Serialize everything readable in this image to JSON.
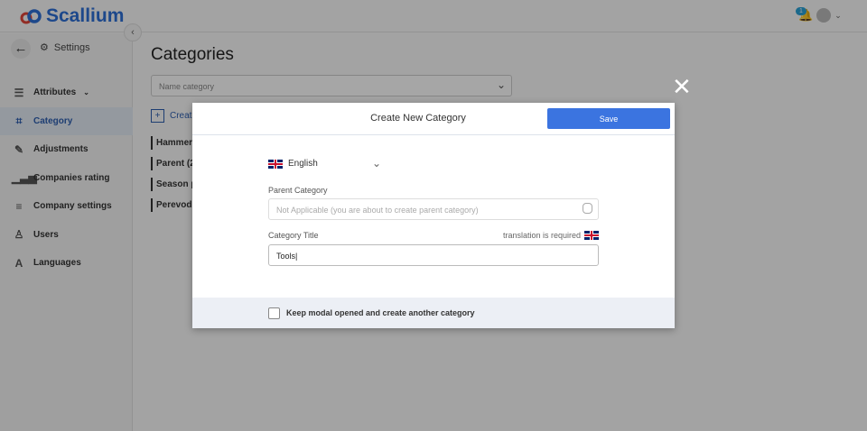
{
  "app": {
    "name": "Scallium",
    "notification_count": "1"
  },
  "sidebar": {
    "back_label": "Settings",
    "items": [
      {
        "label": "Attributes",
        "icon": "list-plus-icon"
      },
      {
        "label": "Category",
        "icon": "hierarchy-icon",
        "active": true
      },
      {
        "label": "Adjustments",
        "icon": "pencil-icon"
      },
      {
        "label": "Companies rating",
        "icon": "bars-icon"
      },
      {
        "label": "Company settings",
        "icon": "sliders-icon"
      },
      {
        "label": "Users",
        "icon": "user-icon"
      },
      {
        "label": "Languages",
        "icon": "translate-icon"
      }
    ]
  },
  "main": {
    "title": "Categories",
    "search_placeholder": "Name category",
    "create_label": "Create",
    "categories": [
      "Hammer",
      "Parent (2",
      "Season p",
      "Perevod"
    ]
  },
  "modal": {
    "title": "Create New Category",
    "save_label": "Save",
    "language": "English",
    "parent_label": "Parent Category",
    "parent_placeholder": "Not Applicable (you are about to create parent category)",
    "title_label": "Category Title",
    "translation_note": "translation is required",
    "title_value": "Tools",
    "keep_open_label": "Keep modal opened and create another category",
    "keep_open_checked": false
  },
  "colors": {
    "accent": "#3b74e0",
    "brand": "#2d6fd6"
  }
}
